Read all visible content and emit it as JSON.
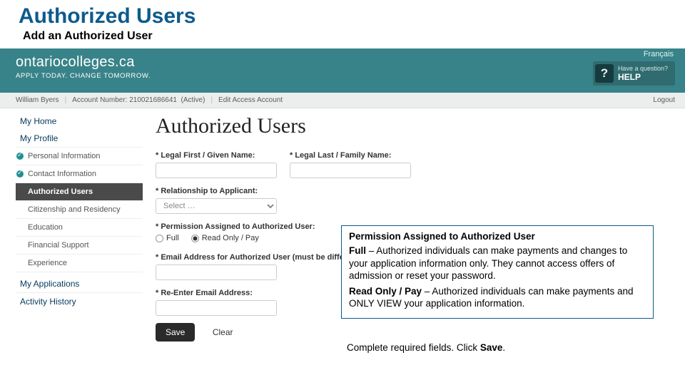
{
  "page": {
    "title": "Authorized Users",
    "subtitle": "Add an Authorized User"
  },
  "header": {
    "brand_line1": "ontariocolleges.ca",
    "brand_line2": "APPLY TODAY. CHANGE TOMORROW.",
    "language": "Français",
    "help_prompt": "Have a question?",
    "help_main": "HELP",
    "qmark": "?"
  },
  "account_bar": {
    "name": "William Byers",
    "acct_label": "Account Number:",
    "acct_number": "210021686641",
    "status": "(Active)",
    "edit": "Edit Access Account",
    "logout": "Logout"
  },
  "sidebar": {
    "top1": "My Home",
    "top2": "My Profile",
    "items": [
      "Personal Information",
      "Contact Information",
      "Authorized Users",
      "Citizenship and Residency",
      "Education",
      "Financial Support",
      "Experience"
    ],
    "bottom1": "My Applications",
    "bottom2": "Activity History"
  },
  "form": {
    "heading": "Authorized Users",
    "first_label": "* Legal First / Given Name:",
    "last_label": "* Legal Last / Family Name:",
    "rel_label": "* Relationship to Applicant:",
    "rel_placeholder": "Select …",
    "perm_label": "* Permission Assigned to Authorized User:",
    "perm_full": "Full",
    "perm_read": "Read Only / Pay",
    "email_label": "* Email Address for Authorized User (must be different",
    "reemail_label": "* Re-Enter Email Address:",
    "save": "Save",
    "clear": "Clear"
  },
  "callout": {
    "title": "Permission Assigned to Authorized User",
    "full_lead": "Full",
    "full_text": " – Authorized individuals can make payments and changes to your application information only. They cannot access offers of admission or reset your password.",
    "read_lead": "Read Only / Pay",
    "read_text": " – Authorized individuals can make payments and ONLY VIEW your application information.",
    "instr_pre": "Complete required fields. Click ",
    "instr_bold": "Save",
    "instr_post": "."
  }
}
